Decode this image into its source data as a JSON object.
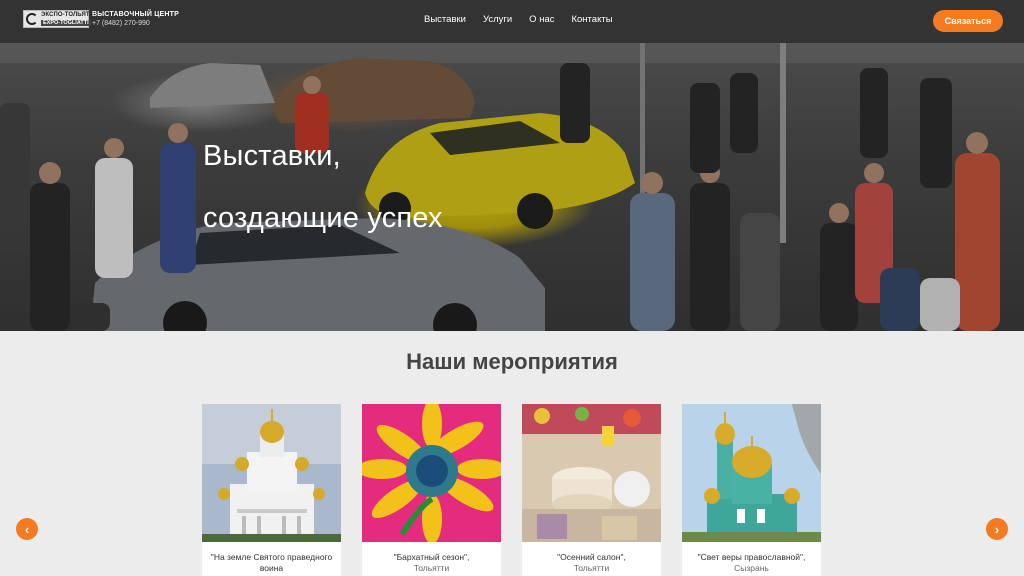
{
  "header": {
    "logo": {
      "line1": "ЭКСПО-ТОЛЬЯТТИ",
      "line2": "EXPO-TOGLIATTI"
    },
    "brand_title": "ВЫСТАВОЧНЫЙ ЦЕНТР",
    "phone": "+7 (8482) 270-990",
    "nav": [
      {
        "label": "Выставки"
      },
      {
        "label": "Услуги"
      },
      {
        "label": "О нас"
      },
      {
        "label": "Контакты"
      }
    ],
    "cta_label": "Связаться"
  },
  "hero": {
    "line1": "Выставки,",
    "line2": "создающие успех"
  },
  "events": {
    "title": "Наши мероприятия",
    "cards": [
      {
        "title": "\"На земле Святого праведного воина",
        "city": ""
      },
      {
        "title": "\"Бархатный сезон\",",
        "city": "Тольятти"
      },
      {
        "title": "\"Осенний салон\",",
        "city": "Тольятти"
      },
      {
        "title": "\"Свет веры православной\",",
        "city": "Сызрань"
      }
    ]
  },
  "colors": {
    "header_bg": "#333333",
    "accent": "#f47b20",
    "page_bg": "#ececec"
  },
  "icons": {
    "prev": "chevron-left-icon",
    "next": "chevron-right-icon"
  }
}
